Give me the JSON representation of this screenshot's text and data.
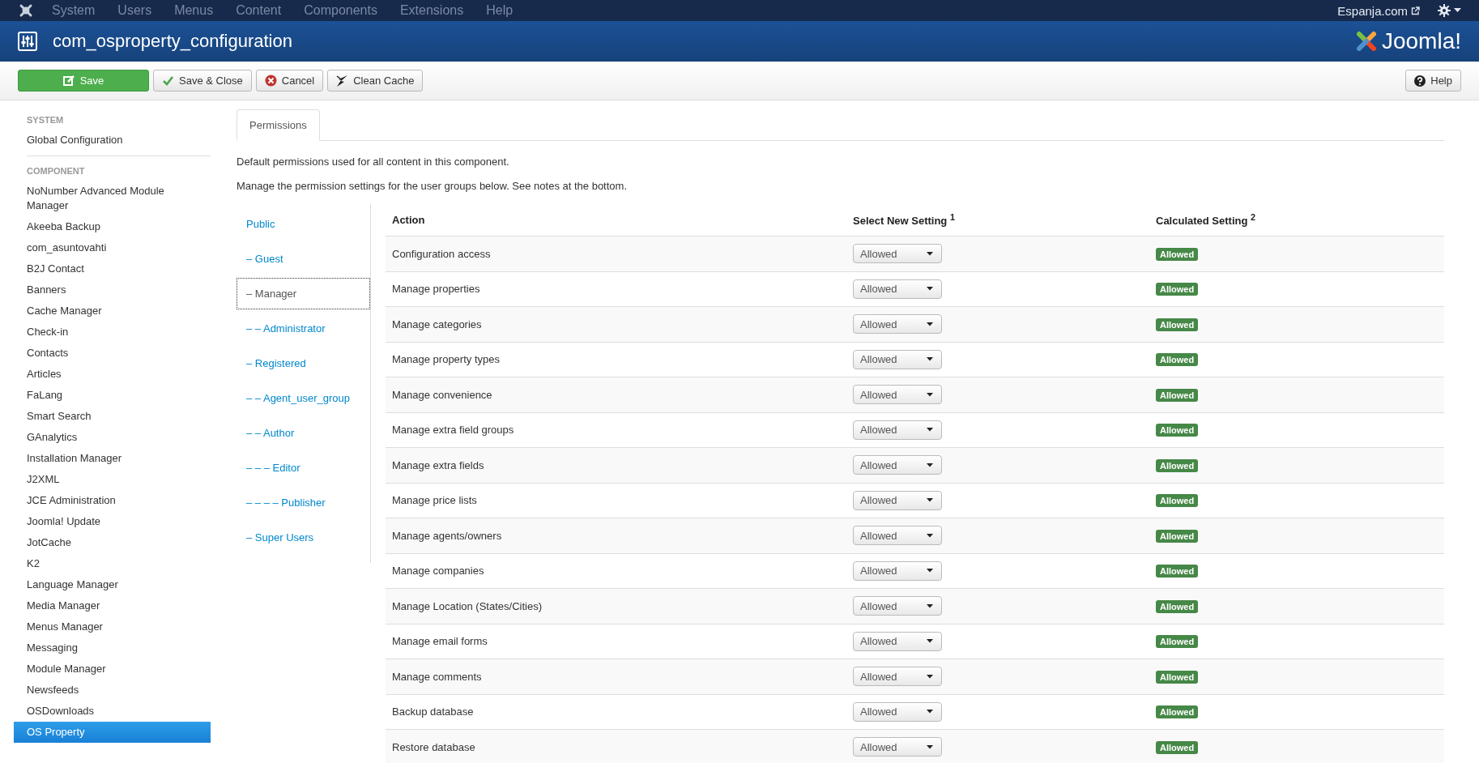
{
  "top_menu": {
    "items": [
      "System",
      "Users",
      "Menus",
      "Content",
      "Components",
      "Extensions",
      "Help"
    ],
    "site_link": "Espanja.com"
  },
  "header": {
    "title": "com_osproperty_configuration",
    "logo_text": "Joomla!"
  },
  "toolbar": {
    "buttons": [
      {
        "label": "Save",
        "kind": "save"
      },
      {
        "label": "Save & Close",
        "kind": "check"
      },
      {
        "label": "Cancel",
        "kind": "cancel"
      },
      {
        "label": "Clean Cache",
        "kind": "clean"
      }
    ],
    "help": "Help"
  },
  "sidebar": {
    "sections": [
      {
        "heading": "SYSTEM",
        "items": [
          {
            "label": "Global Configuration",
            "selected": false
          }
        ]
      },
      {
        "heading": "COMPONENT",
        "items": [
          {
            "label": "NoNumber Advanced Module Manager",
            "selected": false
          },
          {
            "label": "Akeeba Backup",
            "selected": false
          },
          {
            "label": "com_asuntovahti",
            "selected": false
          },
          {
            "label": "B2J Contact",
            "selected": false
          },
          {
            "label": "Banners",
            "selected": false
          },
          {
            "label": "Cache Manager",
            "selected": false
          },
          {
            "label": "Check-in",
            "selected": false
          },
          {
            "label": "Contacts",
            "selected": false
          },
          {
            "label": "Articles",
            "selected": false
          },
          {
            "label": "FaLang",
            "selected": false
          },
          {
            "label": "Smart Search",
            "selected": false
          },
          {
            "label": "GAnalytics",
            "selected": false
          },
          {
            "label": "Installation Manager",
            "selected": false
          },
          {
            "label": "J2XML",
            "selected": false
          },
          {
            "label": "JCE Administration",
            "selected": false
          },
          {
            "label": "Joomla! Update",
            "selected": false
          },
          {
            "label": "JotCache",
            "selected": false
          },
          {
            "label": "K2",
            "selected": false
          },
          {
            "label": "Language Manager",
            "selected": false
          },
          {
            "label": "Media Manager",
            "selected": false
          },
          {
            "label": "Menus Manager",
            "selected": false
          },
          {
            "label": "Messaging",
            "selected": false
          },
          {
            "label": "Module Manager",
            "selected": false
          },
          {
            "label": "Newsfeeds",
            "selected": false
          },
          {
            "label": "OSDownloads",
            "selected": false
          },
          {
            "label": "OS Property",
            "selected": true
          }
        ]
      }
    ]
  },
  "tabs": [
    {
      "label": "Permissions",
      "selected": true
    }
  ],
  "intro": [
    "Default permissions used for all content in this component.",
    "Manage the permission settings for the user groups below. See notes at the bottom."
  ],
  "groups": [
    {
      "label": "Public",
      "selected": false
    },
    {
      "label": "– Guest",
      "selected": false
    },
    {
      "label": "– Manager",
      "selected": true
    },
    {
      "label": "– – Administrator",
      "selected": false
    },
    {
      "label": "– Registered",
      "selected": false
    },
    {
      "label": "– – Agent_user_group",
      "selected": false
    },
    {
      "label": "– – Author",
      "selected": false
    },
    {
      "label": "– – – Editor",
      "selected": false
    },
    {
      "label": "– – – – Publisher",
      "selected": false
    },
    {
      "label": "– Super Users",
      "selected": false
    }
  ],
  "table": {
    "columns": [
      "Action",
      "Select New Setting $^{1}$",
      "Calculated Setting $^{2}$"
    ],
    "rows": [
      {
        "action": "Configuration access",
        "setting": "Allowed",
        "calculated": "Allowed"
      },
      {
        "action": "Manage properties",
        "setting": "Allowed",
        "calculated": "Allowed"
      },
      {
        "action": "Manage categories",
        "setting": "Allowed",
        "calculated": "Allowed"
      },
      {
        "action": "Manage property types",
        "setting": "Allowed",
        "calculated": "Allowed"
      },
      {
        "action": "Manage convenience",
        "setting": "Allowed",
        "calculated": "Allowed"
      },
      {
        "action": "Manage extra field groups",
        "setting": "Allowed",
        "calculated": "Allowed"
      },
      {
        "action": "Manage extra fields",
        "setting": "Allowed",
        "calculated": "Allowed"
      },
      {
        "action": "Manage price lists",
        "setting": "Allowed",
        "calculated": "Allowed"
      },
      {
        "action": "Manage agents/owners",
        "setting": "Allowed",
        "calculated": "Allowed"
      },
      {
        "action": "Manage companies",
        "setting": "Allowed",
        "calculated": "Allowed"
      },
      {
        "action": "Manage Location (States/Cities)",
        "setting": "Allowed",
        "calculated": "Allowed"
      },
      {
        "action": "Manage email forms",
        "setting": "Allowed",
        "calculated": "Allowed"
      },
      {
        "action": "Manage comments",
        "setting": "Allowed",
        "calculated": "Allowed"
      },
      {
        "action": "Backup database",
        "setting": "Allowed",
        "calculated": "Allowed"
      },
      {
        "action": "Restore database",
        "setting": "Allowed",
        "calculated": "Allowed"
      }
    ]
  }
}
